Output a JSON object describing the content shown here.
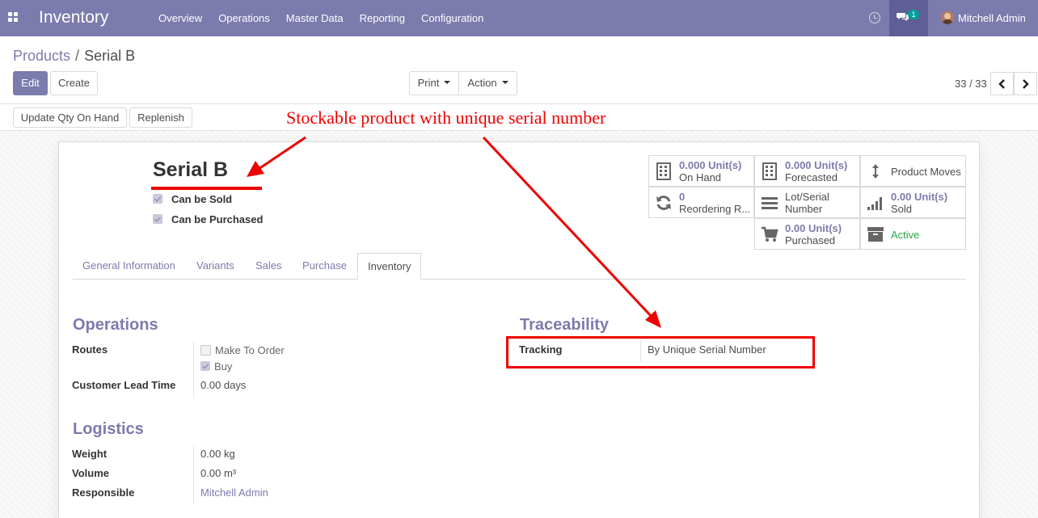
{
  "navbar": {
    "app_title": "Inventory",
    "menu": [
      "Overview",
      "Operations",
      "Master Data",
      "Reporting",
      "Configuration"
    ],
    "messages_count": "1",
    "user_name": "Mitchell Admin"
  },
  "breadcrumb": {
    "parent": "Products",
    "current": "Serial B"
  },
  "control": {
    "edit_label": "Edit",
    "create_label": "Create",
    "print_label": "Print",
    "action_label": "Action",
    "pager": "33 / 33"
  },
  "statusbar": {
    "update_qty_label": "Update Qty On Hand",
    "replenish_label": "Replenish"
  },
  "annotation": {
    "text": "Stockable product with unique serial number"
  },
  "product": {
    "name": "Serial B",
    "can_be_sold": "Can be Sold",
    "can_be_purchased": "Can be Purchased"
  },
  "smart_buttons": {
    "on_hand": {
      "value": "0.000",
      "unit": "Unit(s)",
      "label": "On Hand"
    },
    "forecasted": {
      "value": "0.000",
      "unit": "Unit(s)",
      "label": "Forecasted"
    },
    "product_moves": {
      "label": "Product Moves"
    },
    "reordering": {
      "value": "0",
      "label": "Reordering R..."
    },
    "lot_serial": {
      "label1": "Lot/Serial",
      "label2": "Number"
    },
    "sold": {
      "value": "0.00",
      "unit": "Unit(s)",
      "label": "Sold"
    },
    "purchased": {
      "value": "0.00",
      "unit": "Unit(s)",
      "label": "Purchased"
    },
    "active": {
      "label": "Active"
    }
  },
  "tabs": [
    "General Information",
    "Variants",
    "Sales",
    "Purchase",
    "Inventory"
  ],
  "operations": {
    "title": "Operations",
    "routes_label": "Routes",
    "route_mto": "Make To Order",
    "route_buy": "Buy",
    "lead_time_label": "Customer Lead Time",
    "lead_time_value": "0.00 days"
  },
  "traceability": {
    "title": "Traceability",
    "tracking_label": "Tracking",
    "tracking_value": "By Unique Serial Number"
  },
  "logistics": {
    "title": "Logistics",
    "weight_label": "Weight",
    "weight_value": "0.00",
    "weight_unit": "kg",
    "volume_label": "Volume",
    "volume_value": "0.00",
    "volume_unit": "m³",
    "responsible_label": "Responsible",
    "responsible_value": "Mitchell Admin"
  },
  "colors": {
    "brand": "#7c7bad",
    "annotation": "#ee0000",
    "active": "#28a745"
  }
}
